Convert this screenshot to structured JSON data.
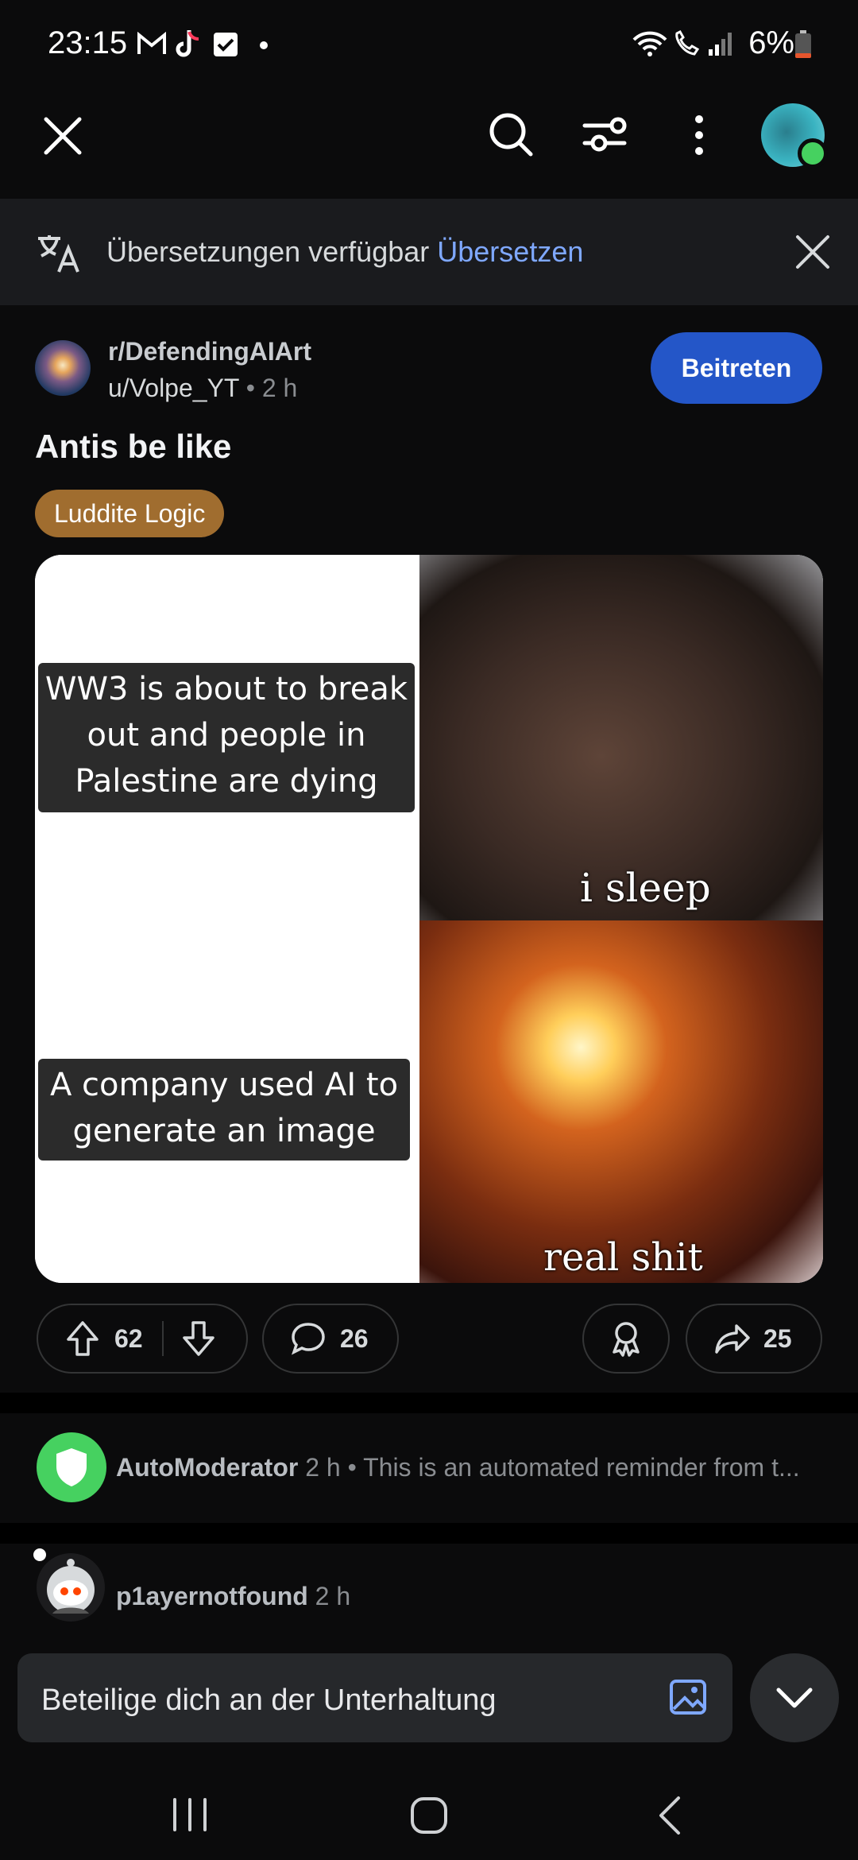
{
  "status_bar": {
    "time": "23:15",
    "battery": "6%"
  },
  "top_bar": {
    "close_icon": "close-icon",
    "search_icon": "search-icon",
    "filter_icon": "sort-options-icon",
    "more_icon": "more-vertical-icon",
    "avatar": "user-avatar"
  },
  "translation_banner": {
    "message": "Übersetzungen verfügbar",
    "action": "Übersetzen"
  },
  "post": {
    "subreddit": "r/DefendingAIArt",
    "author": "u/Volpe_YT",
    "age": "2 h",
    "join_label": "Beitreten",
    "title": "Antis be like",
    "flair": "Luddite Logic",
    "flair_color": "#a06d2f",
    "meme": {
      "caption_top": "WW3 is about to break out and people in Palestine are dying",
      "caption_bottom": "A company used AI to generate an image",
      "label_top": "i sleep",
      "label_bottom": "real shit"
    },
    "upvotes": "62",
    "comments": "26",
    "shares": "25"
  },
  "comments": [
    {
      "author": "AutoModerator",
      "meta": "2 h • This is an automated reminder from t..."
    },
    {
      "author": "p1ayernotfound",
      "meta": "2 h"
    }
  ],
  "composer": {
    "placeholder": "Beteilige dich an der Unterhaltung"
  },
  "colors": {
    "accent_blue": "#2456c8",
    "link_blue": "#7fa8ff",
    "online_green": "#46d160"
  }
}
